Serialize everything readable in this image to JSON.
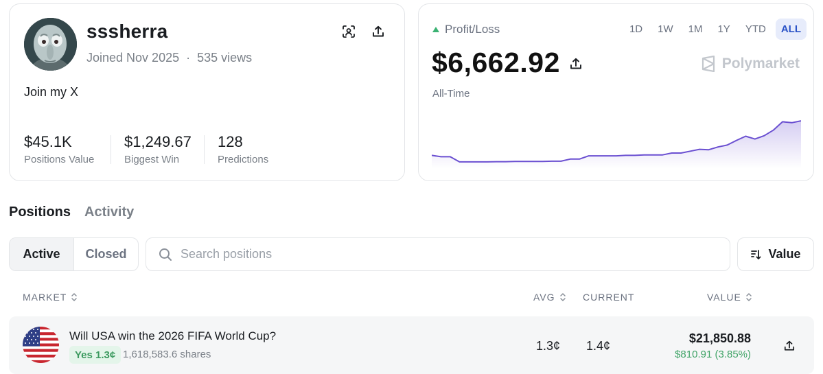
{
  "profile": {
    "username": "sssherra",
    "joined": "Joined Nov 2025",
    "separator": "·",
    "views": "535 views",
    "bio": "Join my X",
    "stats": [
      {
        "value": "$45.1K",
        "label": "Positions Value"
      },
      {
        "value": "$1,249.67",
        "label": "Biggest Win"
      },
      {
        "value": "128",
        "label": "Predictions"
      }
    ]
  },
  "pnl": {
    "label": "Profit/Loss",
    "value": "$6,662.92",
    "period_label": "All-Time",
    "brand": "Polymarket",
    "ranges": [
      "1D",
      "1W",
      "1M",
      "1Y",
      "YTD",
      "ALL"
    ],
    "active_range": "ALL",
    "colors": {
      "up": "#3bb273",
      "line": "#6a4fd1",
      "accent": "#2b53c7"
    }
  },
  "chart_data": {
    "type": "area",
    "title": "",
    "xlabel": "",
    "ylabel": "",
    "series": [
      {
        "values": [
          0.2,
          0.17,
          0.17,
          0.06,
          0.06,
          0.06,
          0.06,
          0.065,
          0.065,
          0.07,
          0.07,
          0.07,
          0.07,
          0.075,
          0.075,
          0.12,
          0.12,
          0.19,
          0.19,
          0.19,
          0.19,
          0.2,
          0.2,
          0.21,
          0.21,
          0.21,
          0.25,
          0.25,
          0.29,
          0.33,
          0.32,
          0.38,
          0.42,
          0.52,
          0.61,
          0.55,
          0.62,
          0.74,
          0.92,
          0.9,
          0.94
        ]
      }
    ]
  },
  "tabs": {
    "positions": "Positions",
    "activity": "Activity"
  },
  "filters": {
    "active": "Active",
    "closed": "Closed"
  },
  "search": {
    "placeholder": "Search positions"
  },
  "sort": {
    "label": "Value"
  },
  "table": {
    "headers": {
      "market": "MARKET",
      "avg": "AVG",
      "current": "CURRENT",
      "value": "VALUE"
    },
    "rows": [
      {
        "title": "Will USA win the 2026 FIFA World Cup?",
        "outcome": "Yes 1.3¢",
        "shares": "1,618,583.6 shares",
        "avg": "1.3¢",
        "current": "1.4¢",
        "value": "$21,850.88",
        "change": "$810.91 (3.85%)"
      }
    ]
  }
}
